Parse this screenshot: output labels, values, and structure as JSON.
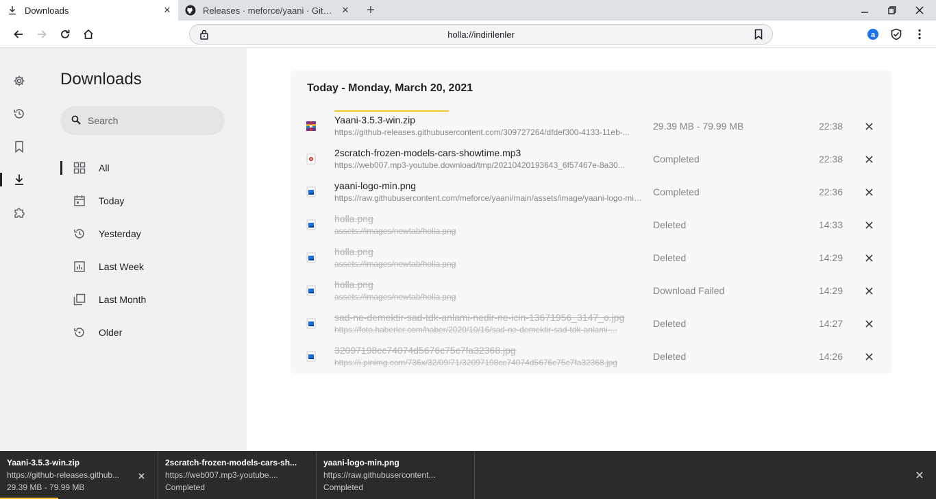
{
  "tabs": [
    {
      "title": "Downloads"
    },
    {
      "title": "Releases · meforce/yaani · GitHub"
    }
  ],
  "address_bar": {
    "url": "holla://indirilenler"
  },
  "side_panel": {
    "title": "Downloads",
    "search_placeholder": "Search",
    "filters": [
      {
        "label": "All"
      },
      {
        "label": "Today"
      },
      {
        "label": "Yesterday"
      },
      {
        "label": "Last Week"
      },
      {
        "label": "Last Month"
      },
      {
        "label": "Older"
      }
    ]
  },
  "downloads": {
    "day_header": "Today - Monday, March 20, 2021",
    "items": [
      {
        "name": "Yaani-3.5.3-win.zip",
        "url": "https://github-releases.githubusercontent.com/309727264/dfdef300-4133-11eb-...",
        "status": "29.39 MB - 79.99 MB",
        "time": "22:38",
        "progress": 0.37
      },
      {
        "name": "2scratch-frozen-models-cars-showtime.mp3",
        "url": "https://web007.mp3-youtube.download/tmp/20210420193643_6f57467e-8a30...",
        "status": "Completed",
        "time": "22:38"
      },
      {
        "name": "yaani-logo-min.png",
        "url": "https://raw.githubusercontent.com/meforce/yaani/main/assets/image/yaani-logo-min.png",
        "status": "Completed",
        "time": "22:36"
      },
      {
        "name": "holla.png",
        "url": "assets://images/newtab/holla.png",
        "status": "Deleted",
        "time": "14:33"
      },
      {
        "name": "holla.png",
        "url": "assets://images/newtab/holla.png",
        "status": "Deleted",
        "time": "14:29"
      },
      {
        "name": "holla.png",
        "url": "assets://images/newtab/holla.png",
        "status": "Download Failed",
        "time": "14:29"
      },
      {
        "name": "sad-ne-demektir-sad-tdk-anlami-nedir-ne-icin-13671956_3147_o.jpg",
        "url": "https://foto.haberler.com/haber/2020/10/16/sad-ne-demektir-sad-tdk-anlami-...",
        "status": "Deleted",
        "time": "14:27"
      },
      {
        "name": "32097198cc74074d5676c75c7fa32368.jpg",
        "url": "https://i.pinimg.com/736x/32/09/71/32097198cc74074d5676c75c7fa32368.jpg",
        "status": "Deleted",
        "time": "14:26"
      }
    ]
  },
  "shelf": {
    "items": [
      {
        "name": "Yaani-3.5.3-win.zip",
        "url": "https://github-releases.github...",
        "status": "29.39 MB - 79.99 MB",
        "progress": 0.37
      },
      {
        "name": "2scratch-frozen-models-cars-sh...",
        "url": "https://web007.mp3-youtube....",
        "status": "Completed"
      },
      {
        "name": "yaani-logo-min.png",
        "url": "https://raw.githubusercontent...",
        "status": "Completed"
      }
    ]
  },
  "icons": {
    "tab_download": "download-icon",
    "tab_github": "github-icon",
    "extension_1": "extension-a-icon",
    "extension_2": "shield-check-icon"
  },
  "colors": {
    "progress": "#f4c430",
    "shelf_bg": "#2b2b2b",
    "extension_blue": "#1a73e8"
  }
}
